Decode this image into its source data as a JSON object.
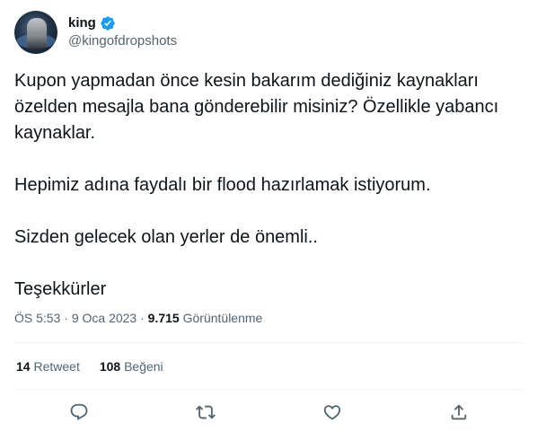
{
  "author": {
    "display_name": "king",
    "handle": "@kingofdropshots",
    "verified_color": "#1d9bf0"
  },
  "tweet": {
    "lines": [
      "Kupon yapmadan önce kesin bakarım dediğiniz kaynakları özelden mesajla bana gönderebilir misiniz? Özellikle yabancı kaynaklar.",
      "Hepimiz adına faydalı bir flood hazırlamak istiyorum.",
      "Sizden gelecek olan yerler de önemli..",
      "Teşekkürler"
    ]
  },
  "meta": {
    "time": "ÖS 5:53",
    "separator": "·",
    "date": "9 Oca 2023",
    "views_count": "9.715",
    "views_label": "Görüntülenme"
  },
  "stats": {
    "retweet_count": "14",
    "retweet_label": "Retweet",
    "like_count": "108",
    "like_label": "Beğeni"
  },
  "actions": {
    "reply": "reply-icon",
    "retweet": "retweet-icon",
    "like": "heart-icon",
    "share": "share-icon"
  },
  "colors": {
    "text_primary": "#0f1419",
    "text_secondary": "#536471",
    "divider": "#eff3f4",
    "brand_blue": "#1d9bf0"
  }
}
